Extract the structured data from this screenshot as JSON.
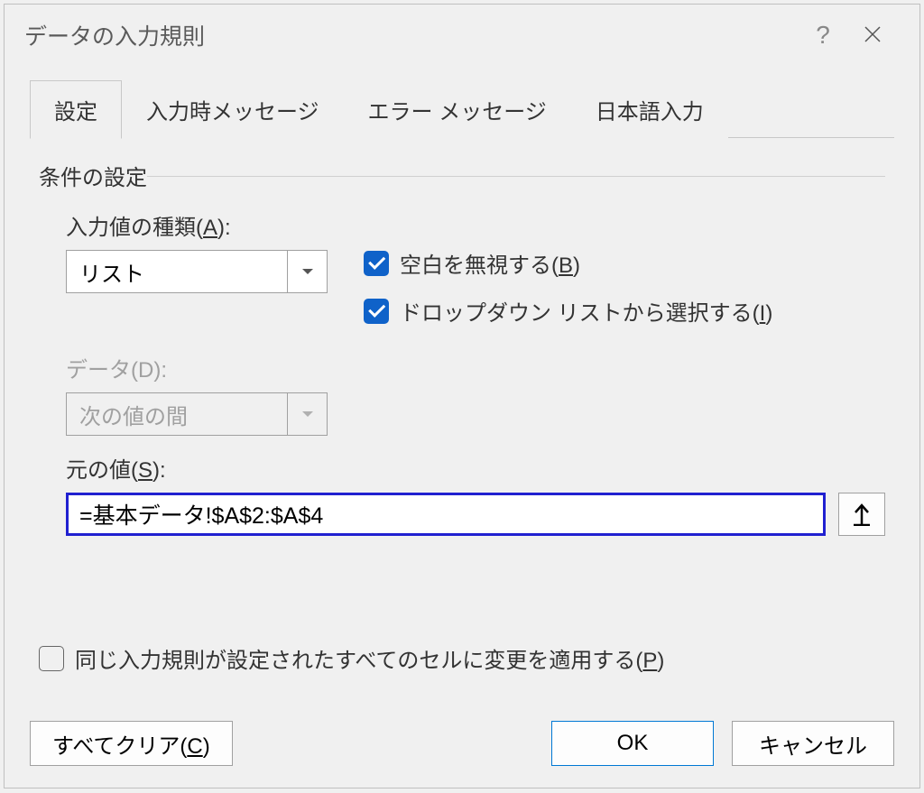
{
  "dialog": {
    "title": "データの入力規則"
  },
  "tabs": [
    {
      "label": "設定"
    },
    {
      "label": "入力時メッセージ"
    },
    {
      "label": "エラー メッセージ"
    },
    {
      "label": "日本語入力"
    }
  ],
  "section": {
    "conditions_label": "条件の設定"
  },
  "fields": {
    "allow": {
      "label_pre": "入力値の種類(",
      "label_key": "A",
      "label_post": "):",
      "value": "リスト"
    },
    "data": {
      "label_pre": "データ(D):",
      "value": "次の値の間"
    },
    "ignore_blank": {
      "label_pre": "空白を無視する(",
      "label_key": "B",
      "label_post": ")"
    },
    "dropdown": {
      "label_pre": "ドロップダウン リストから選択する(",
      "label_key": "I",
      "label_post": ")"
    },
    "source": {
      "label_pre": "元の値(",
      "label_key": "S",
      "label_post": "):",
      "value": "=基本データ!$A$2:$A$4"
    },
    "apply_all": {
      "label_pre": "同じ入力規則が設定されたすべてのセルに変更を適用する(",
      "label_key": "P",
      "label_post": ")"
    }
  },
  "buttons": {
    "clear_pre": "すべてクリア(",
    "clear_key": "C",
    "clear_post": ")",
    "ok": "OK",
    "cancel": "キャンセル"
  }
}
